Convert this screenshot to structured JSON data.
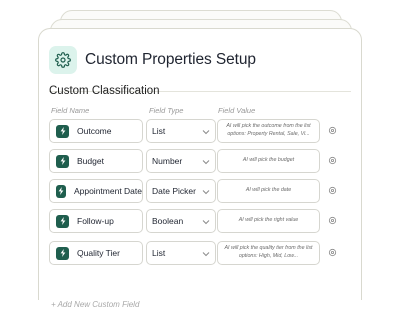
{
  "header": {
    "title": "Custom Properties Setup",
    "icon": "gear-icon"
  },
  "section": {
    "title": "Custom Classification"
  },
  "columns": {
    "field_name": "Field Name",
    "field_type": "Field Type",
    "field_value": "Field Value"
  },
  "rows": [
    {
      "name": "Outcome",
      "type": "List",
      "value_line1": "AI will pick the outcome from the list",
      "value_line2": "options: Property Rental, Sale, Vi..."
    },
    {
      "name": "Budget",
      "type": "Number",
      "value_line1": "AI will pick the budget",
      "value_line2": ""
    },
    {
      "name": "Appointment Date",
      "type": "Date Picker",
      "value_line1": "AI will pick the date",
      "value_line2": ""
    },
    {
      "name": "Follow-up",
      "type": "Boolean",
      "value_line1": "AI will pick the right value",
      "value_line2": ""
    },
    {
      "name": "Quality Tier",
      "type": "List",
      "value_line1": "AI will pick the quality tier from the list",
      "value_line2": "options: High, Mid, Low..."
    }
  ],
  "add_field": {
    "label": "+ Add New Custom Field"
  },
  "colors": {
    "accent": "#1f5e4e",
    "badge_bg": "#dcf3ec"
  }
}
